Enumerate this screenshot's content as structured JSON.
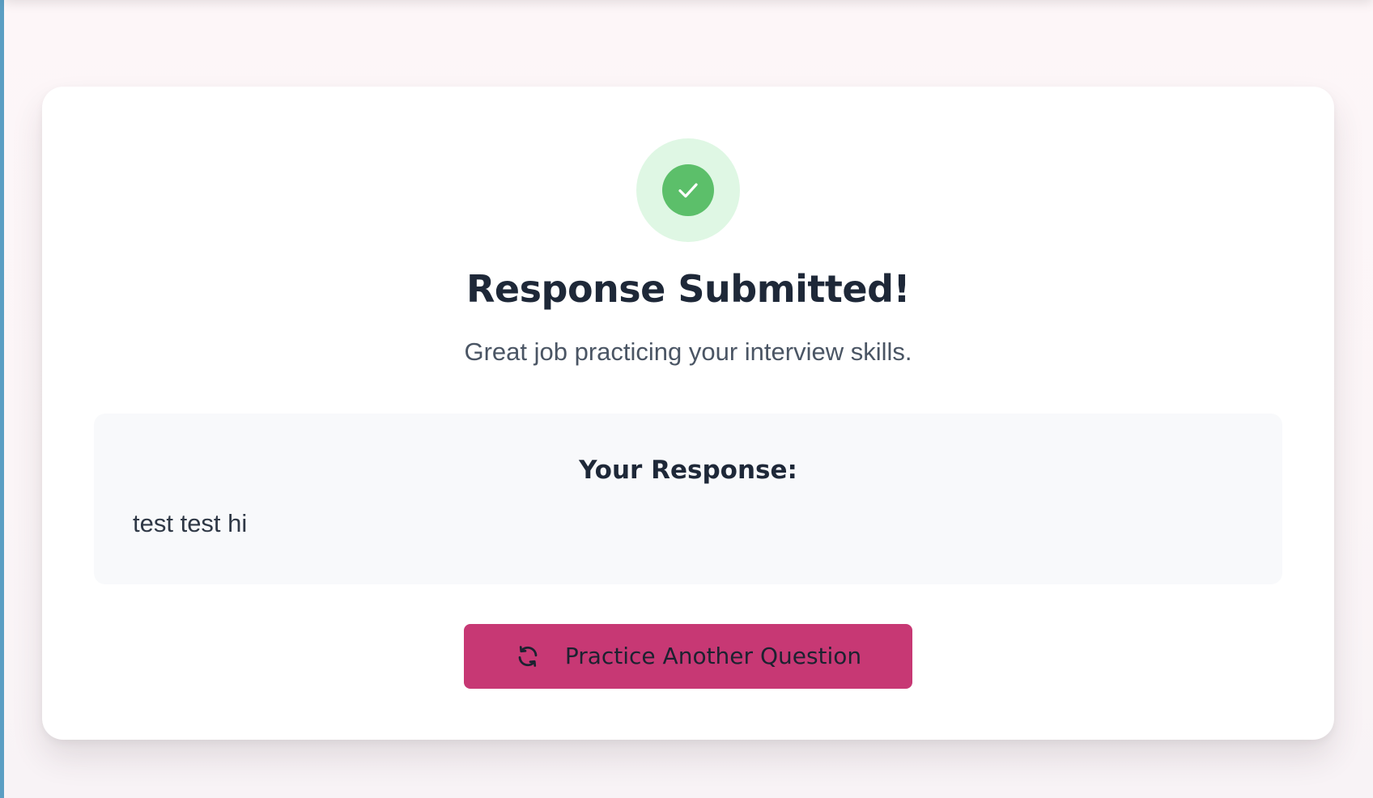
{
  "status": {
    "icon": "check-icon",
    "title": "Response Submitted!",
    "message": "Great job practicing your interview skills."
  },
  "response": {
    "label": "Your Response:",
    "text": "test test hi"
  },
  "actions": {
    "practice_another_label": "Practice Another Question",
    "practice_another_icon": "refresh-icon"
  },
  "colors": {
    "accent": "#c73874",
    "success": "#5cbf6a",
    "success_soft": "#dff7e4",
    "heading": "#1e2838"
  }
}
